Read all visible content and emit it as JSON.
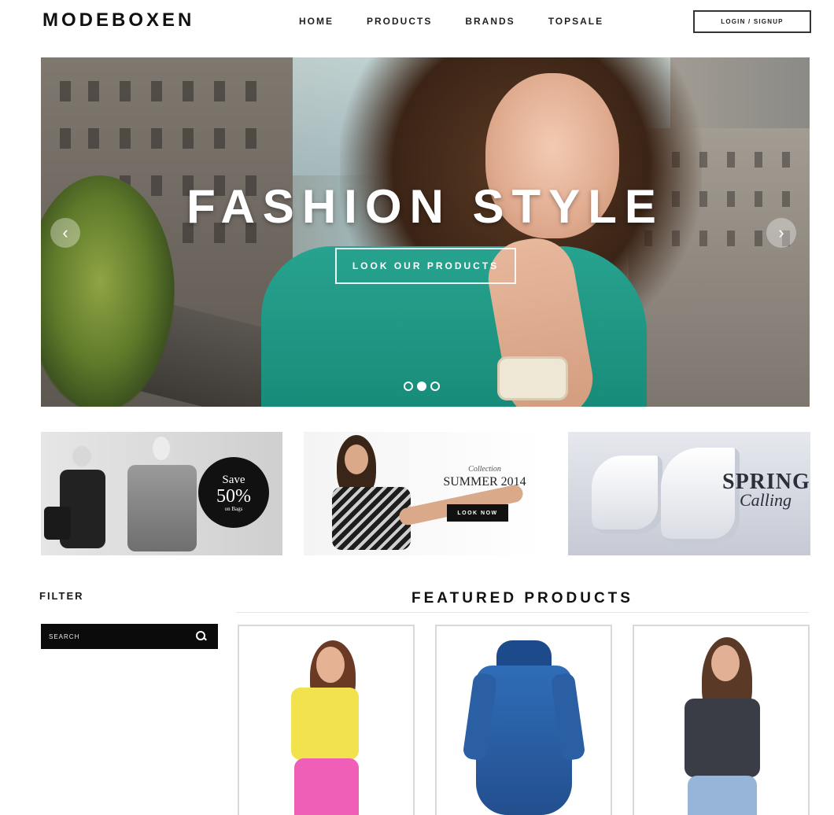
{
  "brand": {
    "name": "MODEBOXEN"
  },
  "nav": {
    "items": [
      {
        "label": "HOME"
      },
      {
        "label": "PRODUCTS"
      },
      {
        "label": "BRANDS"
      },
      {
        "label": "TOPSALE"
      }
    ],
    "login_label": "LOGIN / SIGNUP"
  },
  "hero": {
    "title": "FASHION STYLE",
    "cta_label": "LOOK OUR PRODUCTS",
    "slide_count": 3,
    "active_slide": 2
  },
  "promos": {
    "bags": {
      "save_word": "Save",
      "percent": "50%",
      "sub": "on Bags"
    },
    "collection": {
      "kicker": "Collection",
      "title": "SUMMER 2014",
      "button": "LOOK NOW"
    },
    "spring": {
      "line1": "SPRING",
      "line2": "Calling"
    }
  },
  "filter": {
    "title": "FILTER",
    "search_placeholder": "SEARCH"
  },
  "featured": {
    "title": "FEATURED PRODUCTS"
  },
  "colors": {
    "teal_top": "#1f9a86",
    "black": "#0b0b0b",
    "white": "#ffffff"
  }
}
